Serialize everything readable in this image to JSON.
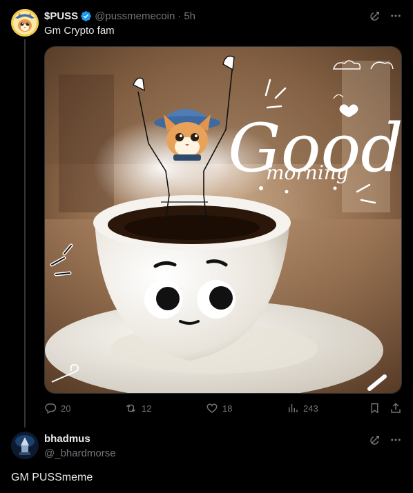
{
  "post": {
    "display_name": "$PUSS",
    "handle": "@pussmemecoin",
    "separator": "·",
    "time": "5h",
    "text": "Gm Crypto fam",
    "avatar_icon": "cat-avatar-icon",
    "verified_icon": "verified-badge-icon",
    "image": {
      "overlay_title": "Good",
      "overlay_subtitle": "morning",
      "description_icon": "coffee-cup-cat-illustration"
    },
    "stats": {
      "replies": "20",
      "reposts": "12",
      "likes": "18",
      "views": "243"
    }
  },
  "reply": {
    "display_name": "bhadmus",
    "handle": "@_bhardmorse",
    "text": "GM PUSSmeme"
  },
  "colors": {
    "background": "#000000",
    "text_primary": "#e7e9ea",
    "text_secondary": "#71767b",
    "verified_blue": "#1d9bf0",
    "divider": "#333639"
  }
}
